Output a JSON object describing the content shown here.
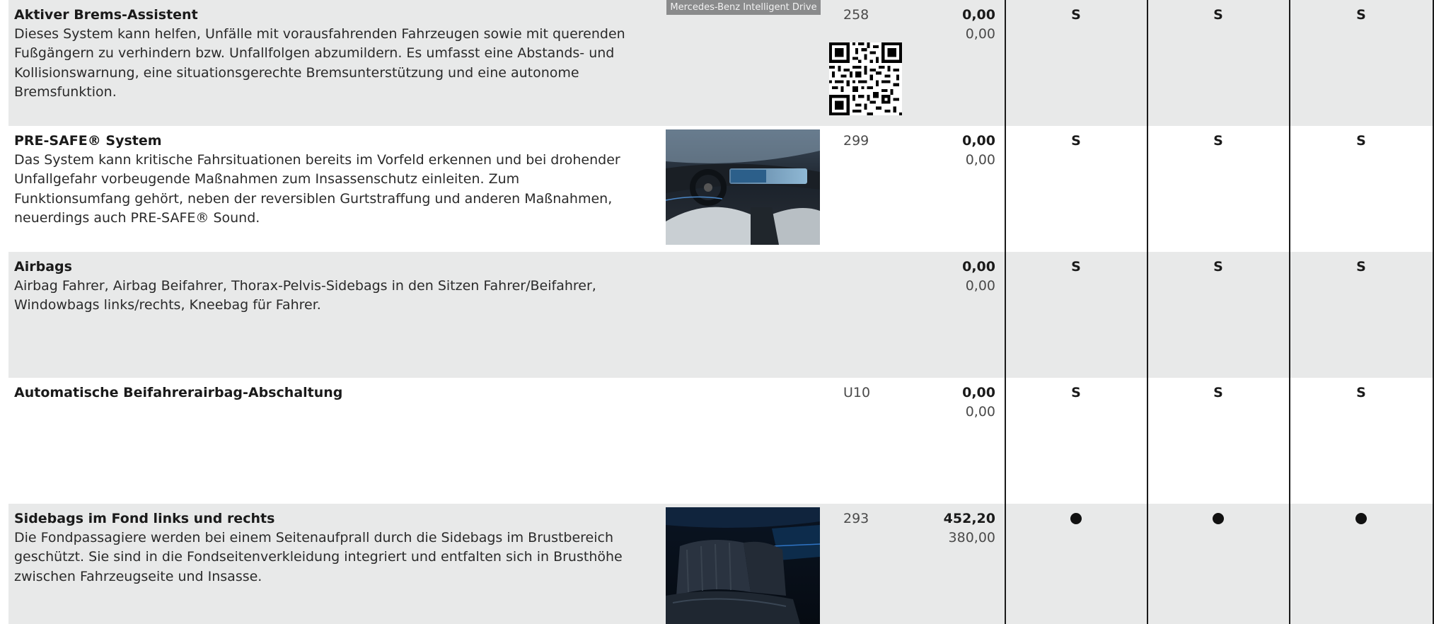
{
  "rows": [
    {
      "title": "Aktiver Brems-Assistent",
      "description": "Dieses System kann helfen, Unfälle mit vorausfahrenden Fahrzeugen sowie mit querenden Fußgängern zu verhindern bzw. Unfallfolgen abzumildern. Es umfasst eine Abstands- und Kollisionswarnung, eine situationsgerechte Bremsunterstützung und eine autonome Bremsfunktion.",
      "badge": "Mercedes-Benz Intelligent Drive",
      "code": "258",
      "price_gross": "0,00",
      "price_net": "0,00",
      "marks": [
        "S",
        "S",
        "S"
      ]
    },
    {
      "title": "PRE-SAFE® System",
      "description": "Das System kann kritische Fahrsituationen bereits im Vorfeld erkennen und bei drohender Unfallgefahr vorbeugende Maßnahmen zum Insassenschutz einleiten. Zum Funktionsumfang gehört, neben der reversiblen Gurtstraffung und anderen Maßnahmen, neuerdings auch PRE-SAFE® Sound.",
      "code": "299",
      "price_gross": "0,00",
      "price_net": "0,00",
      "marks": [
        "S",
        "S",
        "S"
      ]
    },
    {
      "title": "Airbags",
      "description": "Airbag Fahrer, Airbag Beifahrer, Thorax-Pelvis-Sidebags in den Sitzen Fahrer/Beifahrer, Windowbags links/rechts, Kneebag für Fahrer.",
      "code": "",
      "price_gross": "0,00",
      "price_net": "0,00",
      "marks": [
        "S",
        "S",
        "S"
      ]
    },
    {
      "title": "Automatische Beifahrerairbag-Abschaltung",
      "description": "",
      "code": "U10",
      "price_gross": "0,00",
      "price_net": "0,00",
      "marks": [
        "S",
        "S",
        "S"
      ]
    },
    {
      "title": "Sidebags im Fond links und rechts",
      "description": "Die Fondpassagiere werden bei einem Seitenaufprall durch die Sidebags im Brustbereich geschützt. Sie sind in die Fondseitenverkleidung integriert und entfalten sich in Brusthöhe zwischen Fahrzeugseite und Insasse.",
      "code": "293",
      "price_gross": "452,20",
      "price_net": "380,00",
      "marks": [
        "optional",
        "optional",
        "optional"
      ]
    }
  ],
  "colors": {
    "row_grey": "#e8e9e9",
    "text": "#1a1a1a",
    "badge_bg": "#8a8b8c"
  }
}
